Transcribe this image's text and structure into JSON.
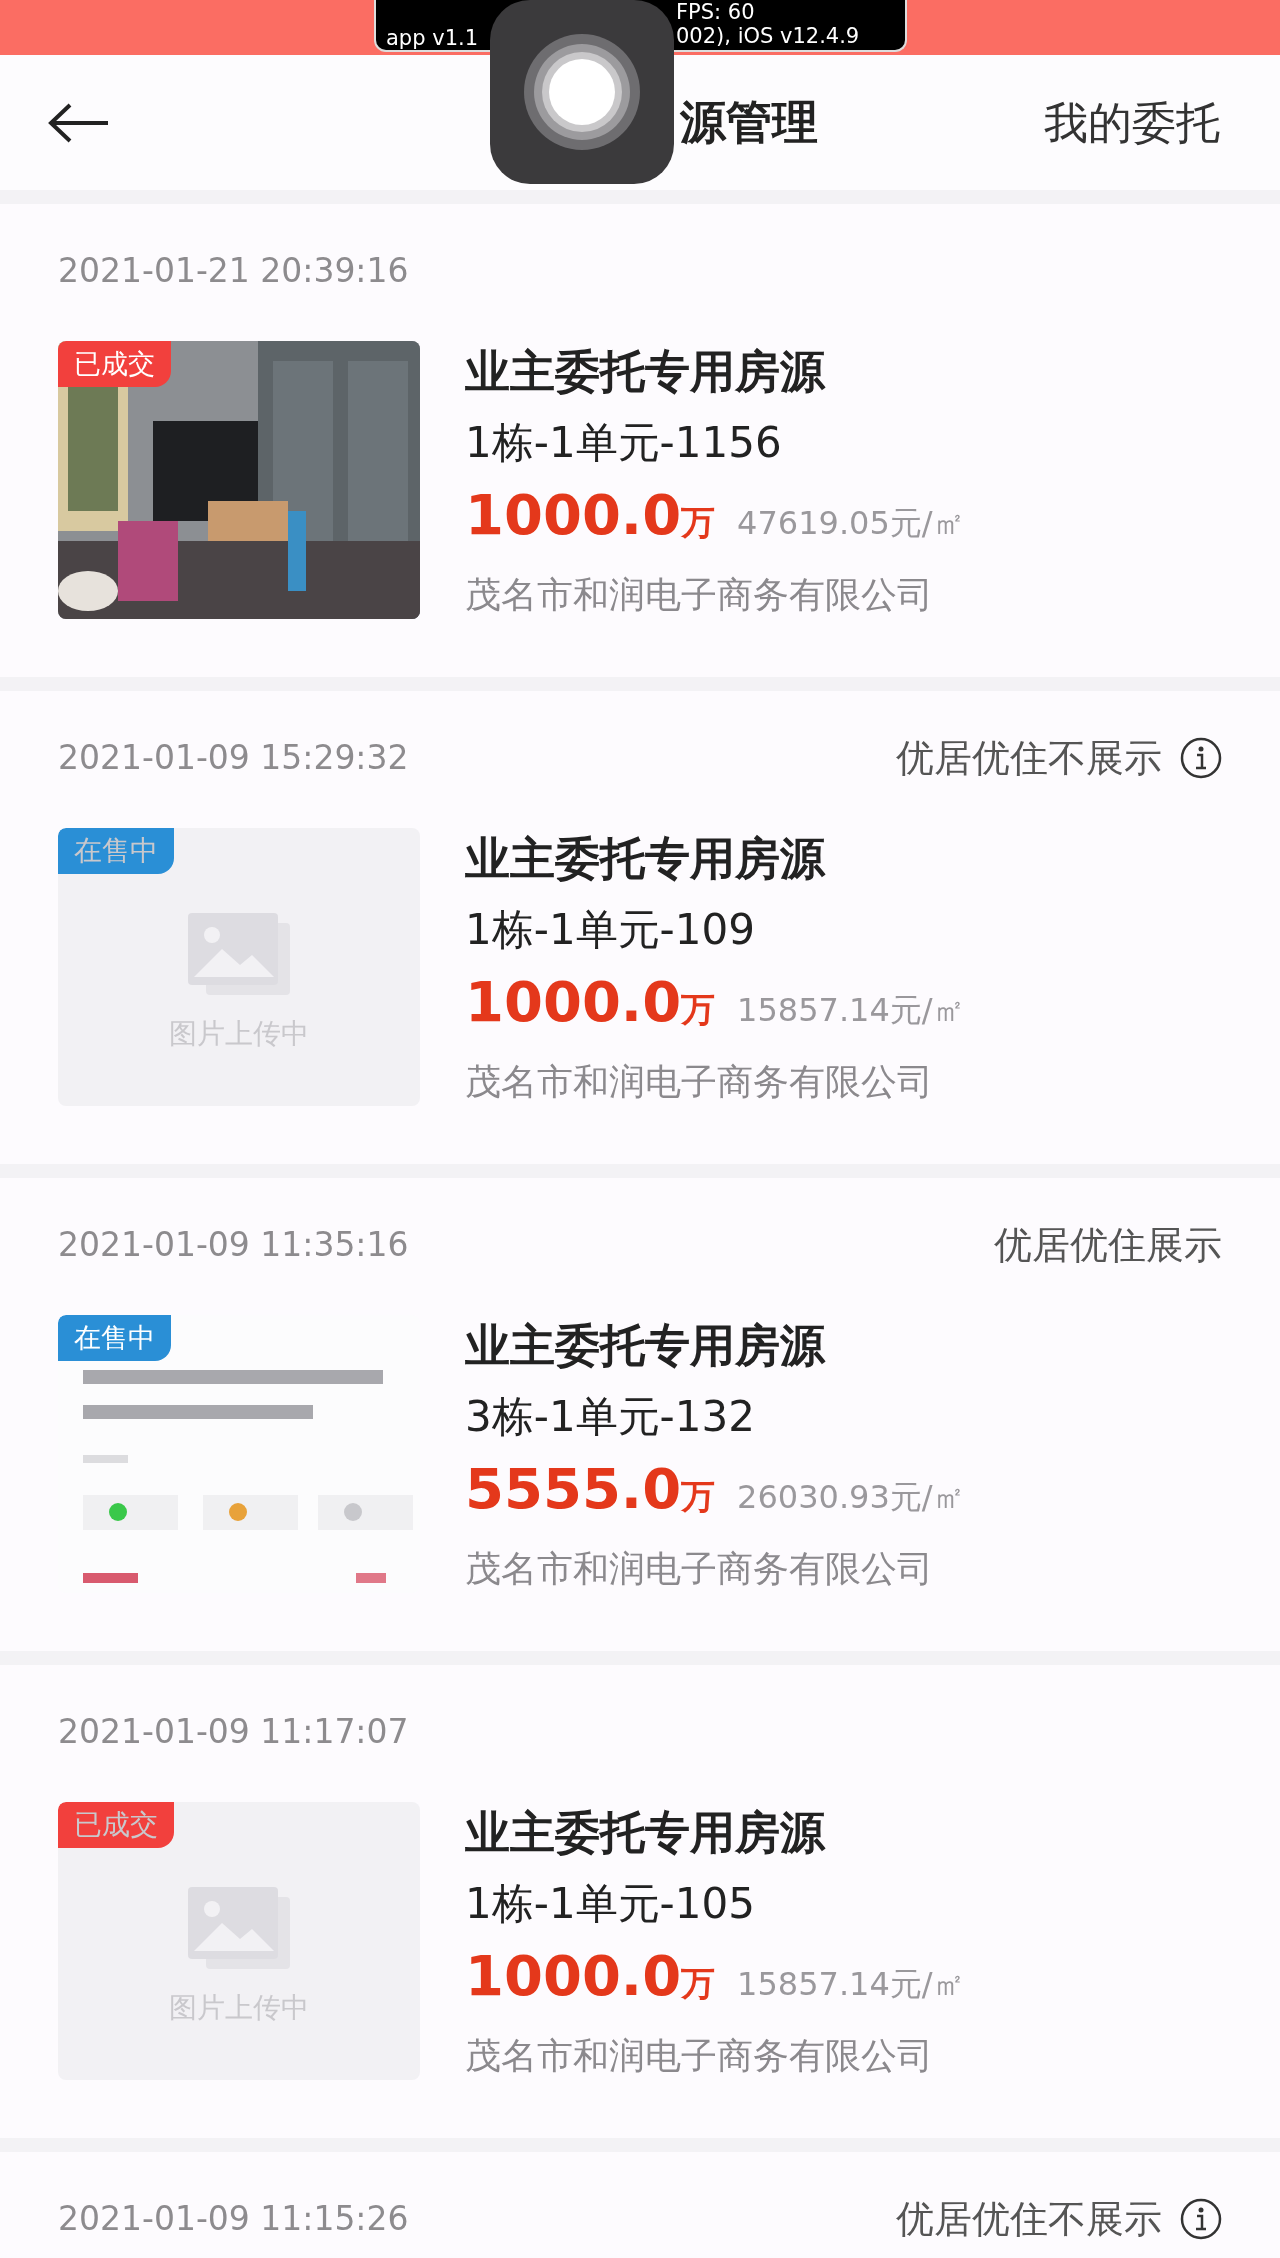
{
  "debug_overlay": {
    "left_lines": [
      "app v1.1"
    ],
    "right_lines": [
      "FPS: 60",
      "002), iOS v12.4.9"
    ]
  },
  "nav": {
    "title": "源管理",
    "right_link": "我的委托"
  },
  "listings": [
    {
      "date": "2021-01-21 20:39:16",
      "status": {
        "text": "已成交",
        "kind": "sold"
      },
      "title": "业主委托专用房源",
      "unit": "1栋-1单元-1156",
      "price": "1000.0",
      "price_unit": "万",
      "unit_price": "47619.05元/㎡",
      "company": "茂名市和润电子商务有限公司"
    },
    {
      "date": "2021-01-09 15:29:32",
      "display": {
        "text": "优居优住不展示",
        "kind": "hidden"
      },
      "status": {
        "text": "在售中",
        "kind": "on_sale"
      },
      "image": {
        "kind": "placeholder",
        "text": "图片上传中"
      },
      "title": "业主委托专用房源",
      "unit": "1栋-1单元-109",
      "price": "1000.0",
      "price_unit": "万",
      "unit_price": "15857.14元/㎡",
      "company": "茂名市和润电子商务有限公司"
    },
    {
      "date": "2021-01-09 11:35:16",
      "display": {
        "text": "优居优住展示",
        "kind": "shown"
      },
      "status": {
        "text": "在售中",
        "kind": "on_sale"
      },
      "image": {
        "kind": "screenshot"
      },
      "title": "业主委托专用房源",
      "unit": "3栋-1单元-132",
      "price": "5555.0",
      "price_unit": "万",
      "unit_price": "26030.93元/㎡",
      "company": "茂名市和润电子商务有限公司"
    },
    {
      "date": "2021-01-09 11:17:07",
      "status": {
        "text": "已成交",
        "kind": "sold"
      },
      "image": {
        "kind": "placeholder",
        "text": "图片上传中"
      },
      "title": "业主委托专用房源",
      "unit": "1栋-1单元-105",
      "price": "1000.0",
      "price_unit": "万",
      "unit_price": "15857.14元/㎡",
      "company": "茂名市和润电子商务有限公司"
    },
    {
      "date": "2021-01-09 11:15:26",
      "display": {
        "text": "优居优住不展示",
        "kind": "hidden"
      }
    }
  ]
}
